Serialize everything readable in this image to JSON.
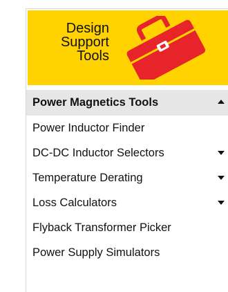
{
  "banner": {
    "title_line1": "Design",
    "title_line2": "Support",
    "title_line3": "Tools",
    "icon": "toolbox-icon",
    "background_color": "#ffd200",
    "icon_color": "#e8242b"
  },
  "menu": {
    "header_label": "Power Magnetics Tools",
    "header_icon": "caret-up-icon",
    "items": [
      {
        "label": "Power Inductor Finder",
        "icon": ""
      },
      {
        "label": "DC-DC Inductor Selectors",
        "icon": "caret-down-icon"
      },
      {
        "label": "Temperature Derating",
        "icon": "caret-down-icon"
      },
      {
        "label": "Loss Calculators",
        "icon": "caret-down-icon"
      },
      {
        "label": "Flyback Transformer Picker",
        "icon": ""
      },
      {
        "label": "Power Supply Simulators",
        "icon": ""
      }
    ]
  }
}
